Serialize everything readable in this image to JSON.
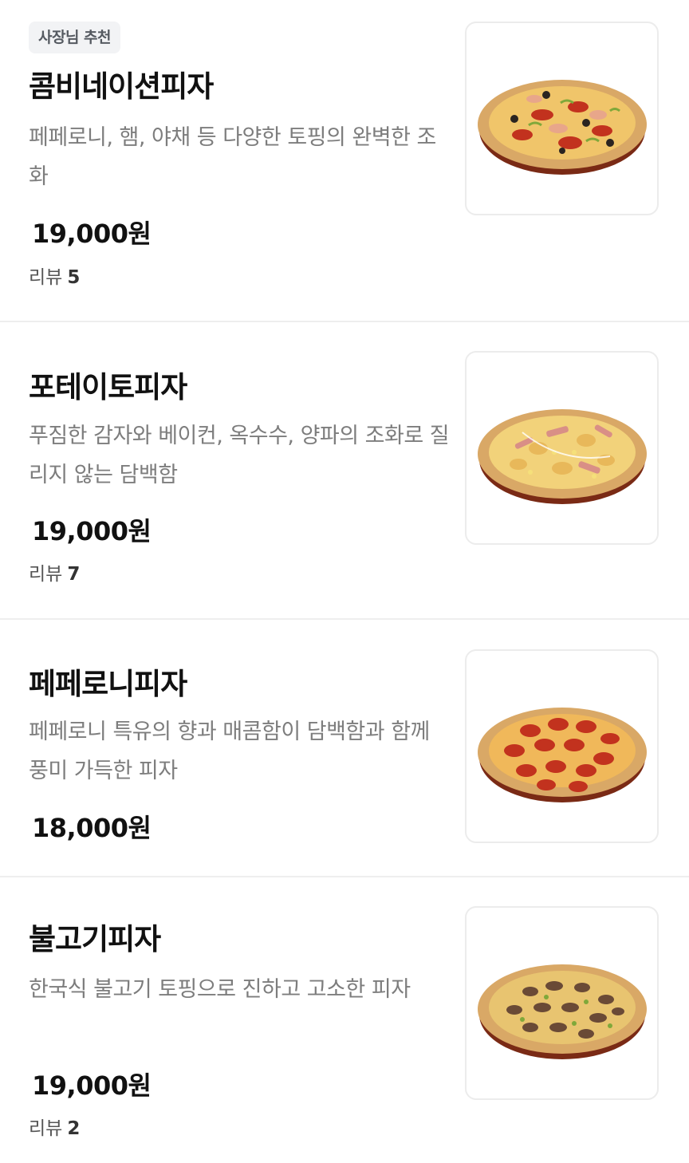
{
  "menu": {
    "items": [
      {
        "badge": "사장님 추천",
        "name": "콤비네이션피자",
        "description": "페페로니, 햄, 야채 등 다양한 토핑의 완벽한 조화",
        "price": "19,000원",
        "reviews_label": "리뷰",
        "reviews_count": "5",
        "image_icon": "combination-pizza-image"
      },
      {
        "name": "포테이토피자",
        "description": "푸짐한 감자와 베이컨, 옥수수, 양파의 조화로 질리지 않는 담백함",
        "price": "19,000원",
        "reviews_label": "리뷰",
        "reviews_count": "7",
        "image_icon": "potato-pizza-image"
      },
      {
        "name": "페페로니피자",
        "description": "페페로니 특유의 향과 매콤함이 담백함과 함께 풍미 가득한 피자",
        "price": "18,000원",
        "image_icon": "pepperoni-pizza-image"
      },
      {
        "name": "불고기피자",
        "description": "한국식 불고기 토핑으로 진하고 고소한 피자",
        "price": "19,000원",
        "reviews_label": "리뷰",
        "reviews_count": "2",
        "image_icon": "bulgogi-pizza-image"
      }
    ]
  },
  "colors": {
    "crust": "#d9a866",
    "cheese": "#f2cf72",
    "pan": "#8a2f18",
    "pepperoni": "#c2321e",
    "olive": "#2a2420",
    "pepper_green": "#7fa83a",
    "bacon": "#d98f86",
    "potato": "#e8b85a",
    "bulgogi": "#6a4a36"
  }
}
